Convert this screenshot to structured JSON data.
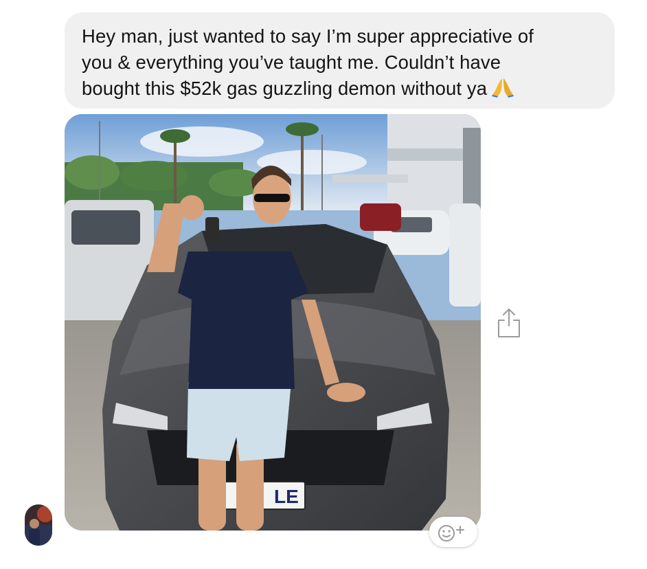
{
  "message": {
    "text": "Hey man, just wanted to say I’m super appreciative of\nyou & everything you’ve taught me. Couldn’t have\nbought this $52k gas guzzling demon without ya",
    "emoji": "folded-hands-emoji"
  },
  "photo": {
    "plate_text": "LE"
  },
  "colors": {
    "bubble": "#f0f0f0",
    "text": "#141414",
    "icon_gray": "#9a9a9a"
  }
}
